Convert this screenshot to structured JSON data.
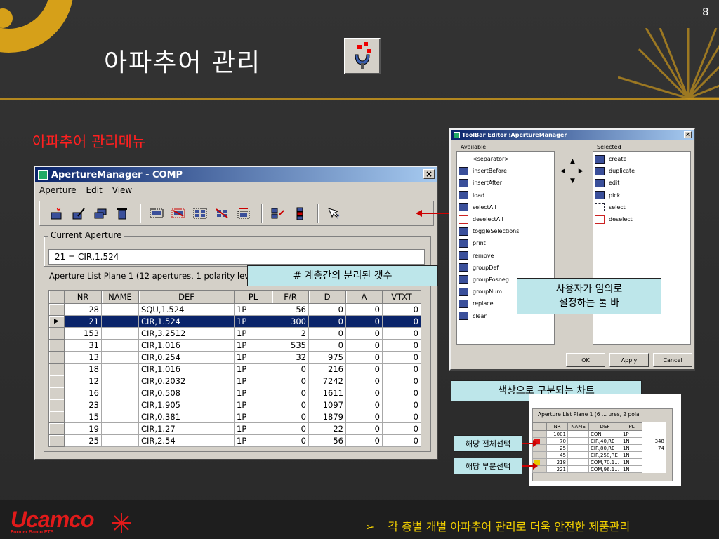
{
  "slide": {
    "page_number": "8",
    "title": "아파추어 관리",
    "subtitle": "아파추어 관리메뉴",
    "footer_bullet": "➢",
    "footer_text": "각 층별 개별 아파추어 관리로 더욱 안전한 제품관리",
    "logo_text": "Ucamco",
    "logo_sub": "Former Barco ETS"
  },
  "main_window": {
    "title": "ApertureManager - COMP",
    "close": "×",
    "menu": [
      "Aperture",
      "Edit",
      "View"
    ],
    "current_aperture_label": "Current Aperture",
    "current_aperture_value": "21 = CIR,1.524",
    "list_label": "Aperture List Plane 1 (12 apertures, 1 polarity levels)",
    "columns": [
      "NR",
      "NAME",
      "DEF",
      "PL",
      "F/R",
      "D",
      "A",
      "VTXT"
    ],
    "selected_marker": "▶",
    "rows": [
      [
        "28",
        "",
        "SQU,1.524",
        "1P",
        "56",
        "0",
        "0",
        "0"
      ],
      [
        "21",
        "",
        "CIR,1.524",
        "1P",
        "300",
        "0",
        "0",
        "0"
      ],
      [
        "153",
        "",
        "CIR,3.2512",
        "1P",
        "2",
        "0",
        "0",
        "0"
      ],
      [
        "31",
        "",
        "CIR,1.016",
        "1P",
        "535",
        "0",
        "0",
        "0"
      ],
      [
        "13",
        "",
        "CIR,0.254",
        "1P",
        "32",
        "975",
        "0",
        "0"
      ],
      [
        "18",
        "",
        "CIR,1.016",
        "1P",
        "0",
        "216",
        "0",
        "0"
      ],
      [
        "12",
        "",
        "CIR,0.2032",
        "1P",
        "0",
        "7242",
        "0",
        "0"
      ],
      [
        "16",
        "",
        "CIR,0.508",
        "1P",
        "0",
        "1611",
        "0",
        "0"
      ],
      [
        "23",
        "",
        "CIR,1.905",
        "1P",
        "0",
        "1097",
        "0",
        "0"
      ],
      [
        "15",
        "",
        "CIR,0.381",
        "1P",
        "0",
        "1879",
        "0",
        "0"
      ],
      [
        "19",
        "",
        "CIR,1.27",
        "1P",
        "0",
        "22",
        "0",
        "0"
      ],
      [
        "25",
        "",
        "CIR,2.54",
        "1P",
        "0",
        "56",
        "0",
        "0"
      ]
    ]
  },
  "callouts": {
    "layer_count": "# 계층간의 분리된 갯수",
    "custom_toolbar_line1": "사용자가 임의로",
    "custom_toolbar_line2": "설정하는 툴 바",
    "color_chart": "색상으로 구분되는 차트",
    "select_all": "해당 전체선택",
    "select_partial": "해당 부분선택"
  },
  "toolbar_editor": {
    "title": "ToolBar Editor :ApertureManager",
    "close": "×",
    "available_label": "Available",
    "selected_label": "Selected",
    "available_items": [
      "<separator>",
      "insertBefore",
      "insertAfter",
      "load",
      "selectAll",
      "deselectAll",
      "toggleSelections",
      "print",
      "remove",
      "groupDef",
      "groupPosneg",
      "groupNum",
      "replace",
      "clean"
    ],
    "selected_items": [
      "create",
      "duplicate",
      "edit",
      "pick",
      "select",
      "deselect"
    ],
    "arrow_up": "▲",
    "arrow_down": "▼",
    "arrow_lr": "◀ ▶",
    "ok": "OK",
    "apply": "Apply",
    "cancel": "Cancel"
  },
  "mini_grid": {
    "label": "Aperture List Plane 1 (6 ... ures, 2 pola",
    "columns": [
      "NR",
      "NAME",
      "DEF",
      "PL"
    ],
    "rows": [
      [
        "1001",
        "",
        "CON",
        "1P",
        ""
      ],
      [
        "70",
        "",
        "CIR,40,RE",
        "1N",
        "348"
      ],
      [
        "25",
        "",
        "CIR,80,RE",
        "1N",
        "74"
      ],
      [
        "45",
        "",
        "CIR,258,RE",
        "1N",
        ""
      ],
      [
        "218",
        "",
        "COM,70.1...",
        "1N",
        ""
      ],
      [
        "221",
        "",
        "COM,96.1...",
        "1N",
        ""
      ]
    ],
    "swatch_colors": [
      "",
      "#e01010",
      "",
      "",
      "#e8c800",
      ""
    ]
  },
  "colors": {
    "accent_gold": "#d6a019",
    "title_red": "#ff2020",
    "footer_yellow": "#f2d000",
    "selection_blue": "#0a246a"
  }
}
